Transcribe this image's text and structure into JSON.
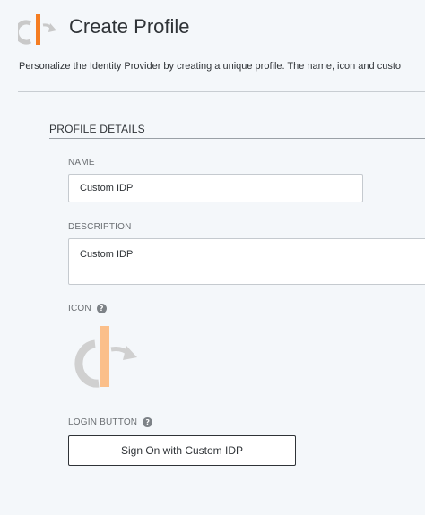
{
  "header": {
    "title": "Create Profile",
    "logo_icon": "openid-logo-icon"
  },
  "intro": {
    "text": "Personalize the Identity Provider by creating a unique profile. The name, icon and custo"
  },
  "section": {
    "title": "PROFILE DETAILS"
  },
  "fields": {
    "name": {
      "label": "NAME",
      "value": "Custom IDP"
    },
    "description": {
      "label": "DESCRIPTION",
      "value": "Custom IDP"
    },
    "icon": {
      "label": "ICON",
      "help": "?",
      "icon_name": "openid-logo-icon"
    },
    "login_button": {
      "label": "LOGIN BUTTON",
      "help": "?",
      "button_text": "Sign On with Custom IDP"
    }
  },
  "colors": {
    "background": "#f4f7fa",
    "logo_orange": "#f57d22",
    "logo_orange_light": "#fbbf8a",
    "logo_gray": "#c9c9c9",
    "text": "#2f3337",
    "label": "#6b6f73"
  }
}
